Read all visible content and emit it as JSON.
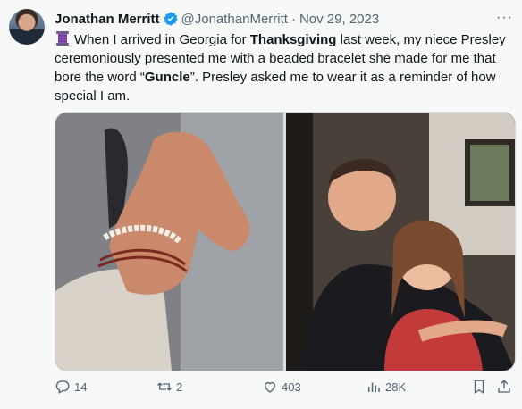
{
  "tweet": {
    "author_name": "Jonathan Merritt",
    "handle": "@JonathanMerritt",
    "separator": "·",
    "date": "Nov 29, 2023",
    "more_label": "···",
    "text": {
      "part1": "When I arrived in Georgia for ",
      "bold1": "Thanksgiving",
      "part2": " last week, my niece Presley ceremoniously presented me with a beaded bracelet she made for me that bore the word “",
      "bold2": "Guncle",
      "part3": "”. Presley asked me to wear it as a reminder of how special I am."
    }
  },
  "actions": {
    "reply_count": "14",
    "retweet_count": "2",
    "like_count": "403",
    "views_count": "28K"
  },
  "icons": {
    "emoji": "thread-spool-icon",
    "verified": "verified-badge-icon",
    "reply": "reply-icon",
    "retweet": "retweet-icon",
    "like": "heart-icon",
    "views": "views-icon",
    "bookmark": "bookmark-icon",
    "share": "share-icon"
  },
  "colors": {
    "verified_blue": "#1d9bf0",
    "secondary_text": "#536471",
    "primary_text": "#0f1419",
    "background": "#f7f9f9"
  }
}
